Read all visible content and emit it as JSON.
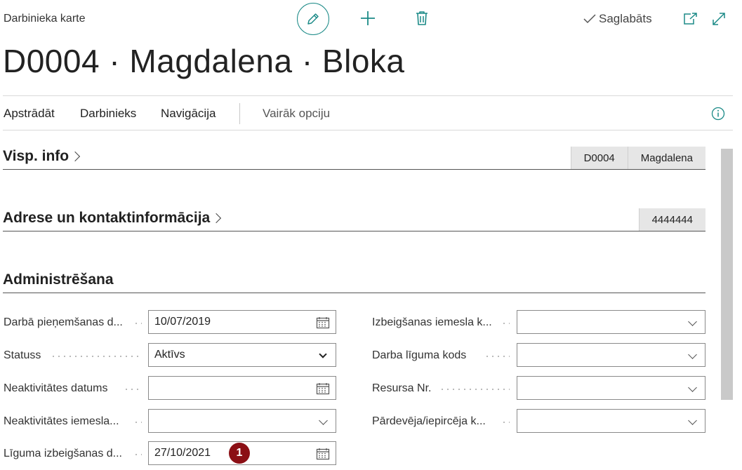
{
  "header": {
    "page_kind": "Darbinieka karte",
    "save_status": "Saglabāts",
    "title": "D0004 · Magdalena · Bloka"
  },
  "icons": {
    "edit": "pencil-icon",
    "new": "plus-icon",
    "delete": "trash-icon",
    "saved": "checkmark-icon",
    "popout": "open-in-new-window-icon",
    "expand": "expand-icon",
    "info": "info-icon",
    "calendar": "calendar-icon",
    "dropdown": "chevron-down-icon"
  },
  "colors": {
    "accent": "#1b8a87",
    "badge": "#8b0f15"
  },
  "actions": {
    "process": "Apstrādāt",
    "employee": "Darbinieks",
    "navigation": "Navigācija",
    "more": "Vairāk opciju"
  },
  "fasttabs": {
    "general": {
      "title": "Visp. info",
      "summary": [
        "D0004",
        "Magdalena"
      ]
    },
    "address": {
      "title": "Adrese un kontaktinformācija",
      "summary": [
        "4444444"
      ]
    },
    "administration": {
      "title": "Administrēšana"
    }
  },
  "fields": {
    "left": [
      {
        "label": "Darbā pieņemšanas d...",
        "value": "10/07/2019",
        "type": "date"
      },
      {
        "label": "Statuss",
        "value": "Aktīvs",
        "type": "select"
      },
      {
        "label": "Neaktivitātes datums",
        "value": "",
        "type": "date"
      },
      {
        "label": "Neaktivitātes iemesla...",
        "value": "",
        "type": "lookup"
      },
      {
        "label": "Līguma izbeigšanas d...",
        "value": "27/10/2021",
        "type": "date"
      }
    ],
    "right": [
      {
        "label": "Izbeigšanas iemesla k...",
        "value": "",
        "type": "lookup"
      },
      {
        "label": "Darba līguma kods",
        "value": "",
        "type": "lookup"
      },
      {
        "label": "Resursa Nr.",
        "value": "",
        "type": "lookup"
      },
      {
        "label": "Pārdevēja/iepircēja k...",
        "value": "",
        "type": "lookup"
      }
    ]
  },
  "badge": "1"
}
